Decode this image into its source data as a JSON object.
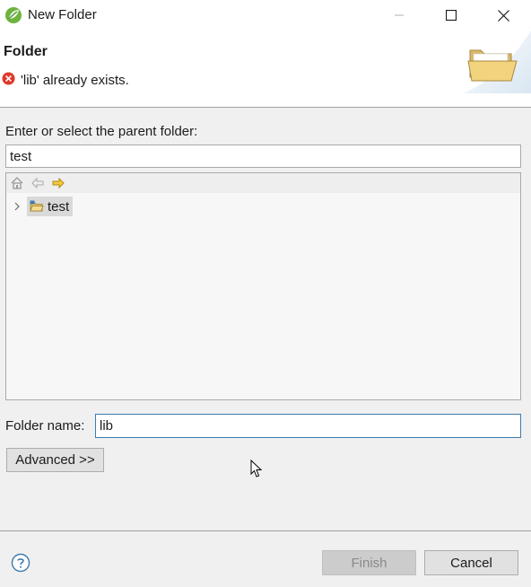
{
  "window": {
    "title": "New Folder",
    "icon": "spring-leaf-icon",
    "controls": [
      "minimize-icon",
      "maximize-icon",
      "close-icon"
    ]
  },
  "header": {
    "title": "Folder",
    "error_message": "'lib' already exists.",
    "error_icon": "error-icon",
    "banner_icon": "folder-icon"
  },
  "parent": {
    "label": "Enter or select the parent folder:",
    "value": "test"
  },
  "tree": {
    "toolbar_icons": [
      "home-icon",
      "back-arrow-icon",
      "forward-arrow-icon"
    ],
    "items": [
      {
        "label": "test",
        "icon": "open-project-folder-icon",
        "expanded": false,
        "selected": true
      }
    ]
  },
  "folder_name": {
    "label": "Folder name:",
    "value": "lib"
  },
  "buttons": {
    "advanced": "Advanced >>",
    "finish": "Finish",
    "cancel": "Cancel",
    "finish_enabled": false
  },
  "colors": {
    "error_red": "#e0392b",
    "spring_green": "#6db33f",
    "focus_border": "#3d7bad",
    "selection_bg": "#d9d9d9"
  }
}
